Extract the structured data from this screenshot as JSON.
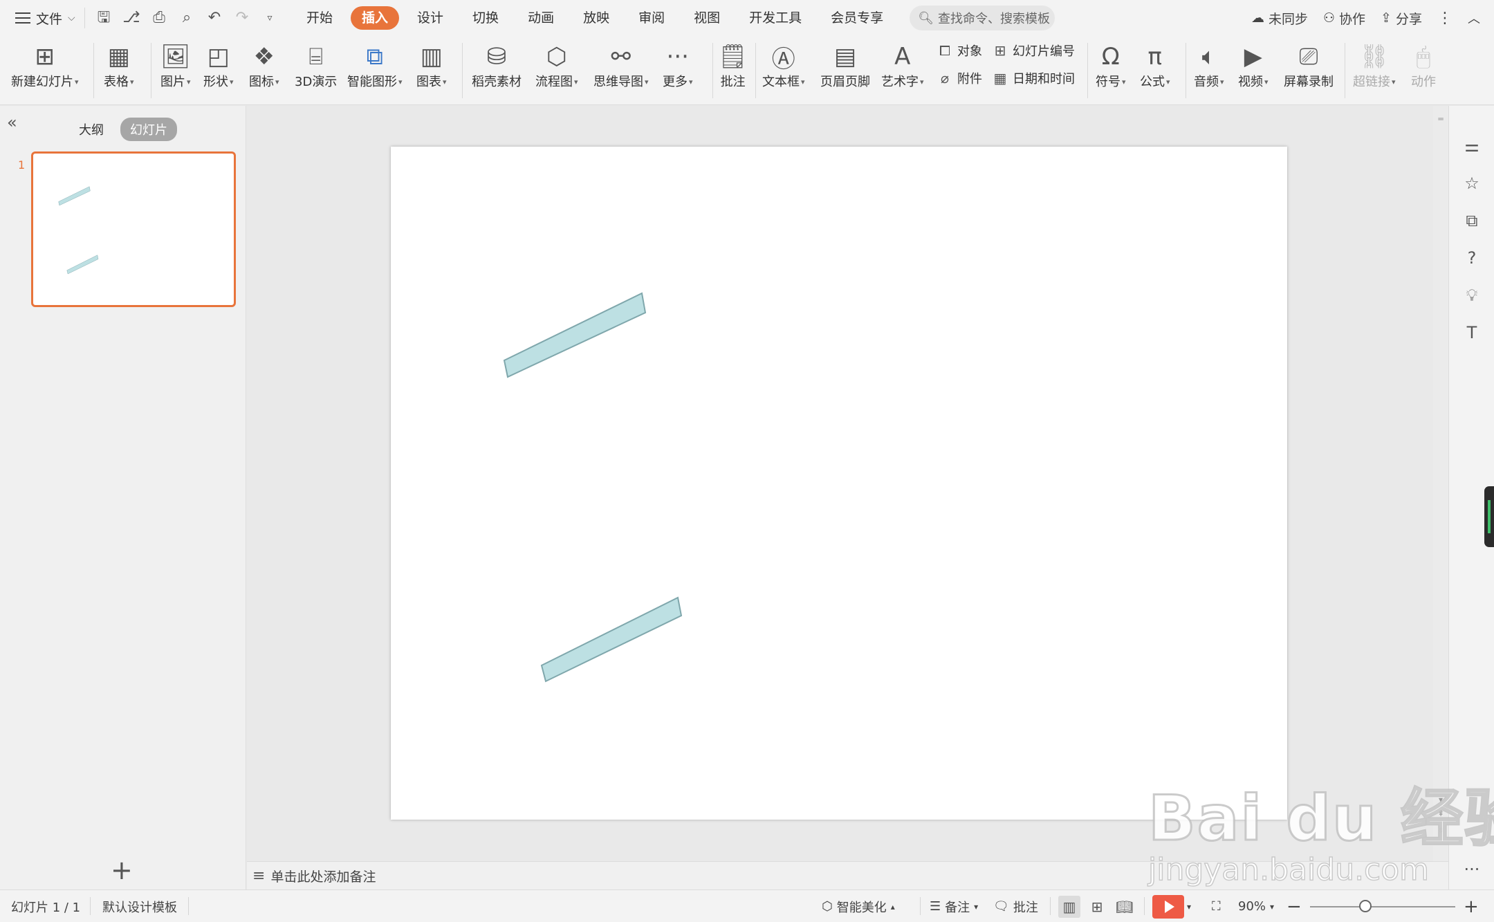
{
  "menubar": {
    "file_label": "文件",
    "tabs": [
      {
        "label": "开始",
        "active": false
      },
      {
        "label": "插入",
        "active": true
      },
      {
        "label": "设计",
        "active": false
      },
      {
        "label": "切换",
        "active": false
      },
      {
        "label": "动画",
        "active": false
      },
      {
        "label": "放映",
        "active": false
      },
      {
        "label": "审阅",
        "active": false
      },
      {
        "label": "视图",
        "active": false
      },
      {
        "label": "开发工具",
        "active": false
      },
      {
        "label": "会员专享",
        "active": false
      }
    ],
    "search_placeholder": "查找命令、搜索模板",
    "sync_label": "未同步",
    "collab_label": "协作",
    "share_label": "分享",
    "accent_color": "#e8743b"
  },
  "ribbon": {
    "new_slide": "新建幻灯片",
    "table": "表格",
    "picture": "图片",
    "shape": "形状",
    "icons": "图标",
    "demo3d": "3D演示",
    "smartart": "智能图形",
    "chart": "图表",
    "material": "稻壳素材",
    "flowchart": "流程图",
    "mindmap": "思维导图",
    "more": "更多",
    "comment": "批注",
    "textbox": "文本框",
    "header_footer": "页眉页脚",
    "wordart": "艺术字",
    "object": "对象",
    "slide_number": "幻灯片编号",
    "attachment": "附件",
    "date_time": "日期和时间",
    "symbol": "符号",
    "formula": "公式",
    "audio": "音频",
    "video": "视频",
    "screen_record": "屏幕录制",
    "hyperlink": "超链接",
    "action": "动作"
  },
  "panel": {
    "outline_tab": "大纲",
    "slides_tab": "幻灯片",
    "slide_number": "1"
  },
  "slide": {
    "shape_fill": "#bde0e3",
    "shape_stroke": "#7fa7ac",
    "shapes": [
      {
        "name": "parallelogram-1"
      },
      {
        "name": "parallelogram-2"
      }
    ]
  },
  "notes": {
    "placeholder": "单击此处添加备注"
  },
  "statusbar": {
    "slide_info": "幻灯片 1 / 1",
    "template": "默认设计模板",
    "beautify": "智能美化",
    "notes": "备注",
    "comments": "批注",
    "zoom": "90%",
    "zoom_level": 0.38,
    "play_color": "#ee5a45"
  },
  "watermark": {
    "brand": "Bai du 经验",
    "url": "jingyan.baidu.com"
  }
}
